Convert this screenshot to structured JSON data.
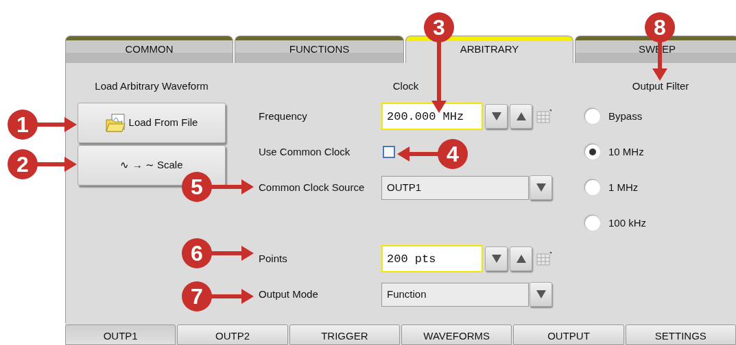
{
  "top_tabs": [
    {
      "label": "COMMON",
      "selected": false
    },
    {
      "label": "FUNCTIONS",
      "selected": false
    },
    {
      "label": "ARBITRARY",
      "selected": true
    },
    {
      "label": "SWEEP",
      "selected": false
    }
  ],
  "load_section": {
    "title": "Load Arbitrary Waveform",
    "buttons": [
      {
        "label": "Load From File",
        "kind": "file"
      },
      {
        "label": "∿ → ∼ Scale",
        "kind": "text"
      }
    ]
  },
  "clock": {
    "title": "Clock",
    "frequency": {
      "label": "Frequency",
      "value": "200.000 MHz"
    },
    "use_common_clock": {
      "label": "Use Common Clock",
      "checked": false
    },
    "common_clock_source": {
      "label": "Common Clock Source",
      "value": "OUTP1"
    },
    "points": {
      "label": "Points",
      "value": "200 pts"
    },
    "output_mode": {
      "label": "Output Mode",
      "value": "Function"
    }
  },
  "output_filter": {
    "title": "Output Filter",
    "options": [
      {
        "label": "Bypass",
        "selected": false
      },
      {
        "label": "10 MHz",
        "selected": true
      },
      {
        "label": "1 MHz",
        "selected": false
      },
      {
        "label": "100 kHz",
        "selected": false
      }
    ]
  },
  "bottom_tabs": [
    {
      "label": "OUTP1",
      "selected": true
    },
    {
      "label": "OUTP2",
      "selected": false
    },
    {
      "label": "TRIGGER",
      "selected": false
    },
    {
      "label": "WAVEFORMS",
      "selected": false
    },
    {
      "label": "OUTPUT",
      "selected": false
    },
    {
      "label": "SETTINGS",
      "selected": false
    }
  ],
  "callouts": [
    {
      "number": "1"
    },
    {
      "number": "2"
    },
    {
      "number": "3"
    },
    {
      "number": "4"
    },
    {
      "number": "5"
    },
    {
      "number": "6"
    },
    {
      "number": "7"
    },
    {
      "number": "8"
    }
  ]
}
